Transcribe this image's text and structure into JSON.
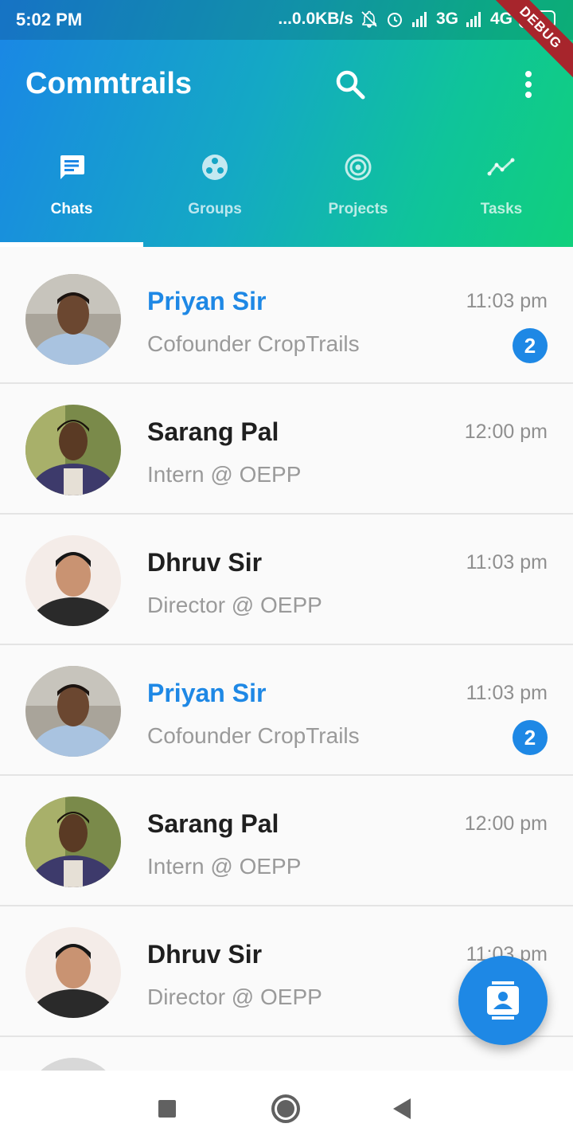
{
  "status_bar": {
    "time": "5:02 PM",
    "speed": "...0.0KB/s",
    "net1": "3G",
    "net2": "4G",
    "battery": "46",
    "debug_label": "DEBUG"
  },
  "app_bar": {
    "title": "Commtrails",
    "icons": [
      "search-icon",
      "more-vert-icon"
    ]
  },
  "tabs": [
    {
      "label": "Chats",
      "icon": "chat-icon",
      "active": true
    },
    {
      "label": "Groups",
      "icon": "groups-icon",
      "active": false
    },
    {
      "label": "Projects",
      "icon": "projects-icon",
      "active": false
    },
    {
      "label": "Tasks",
      "icon": "tasks-icon",
      "active": false
    }
  ],
  "chats": [
    {
      "name": "Priyan Sir",
      "subtitle": "Cofounder CropTrails",
      "time": "11:03 pm",
      "unread": "2"
    },
    {
      "name": "Sarang Pal",
      "subtitle": "Intern @ OEPP",
      "time": "12:00 pm",
      "unread": ""
    },
    {
      "name": "Dhruv Sir",
      "subtitle": "Director @ OEPP",
      "time": "11:03 pm",
      "unread": ""
    },
    {
      "name": "Priyan Sir",
      "subtitle": "Cofounder CropTrails",
      "time": "11:03 pm",
      "unread": "2"
    },
    {
      "name": "Sarang Pal",
      "subtitle": "Intern @ OEPP",
      "time": "12:00 pm",
      "unread": ""
    },
    {
      "name": "Dhruv Sir",
      "subtitle": "Director @ OEPP",
      "time": "11:03 pm",
      "unread": ""
    }
  ],
  "fab": {
    "icon": "contacts-icon"
  },
  "colors": {
    "accent": "#1e88e5",
    "gradient_start": "#1a86e6",
    "gradient_end": "#10d07c"
  }
}
